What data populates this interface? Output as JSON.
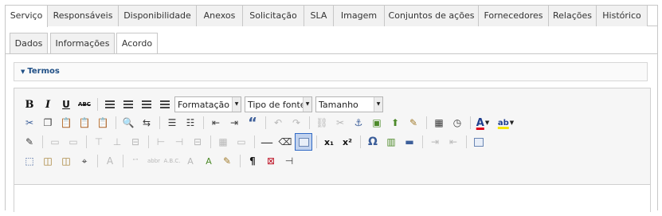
{
  "tabs": [
    {
      "label": "Serviço",
      "active": true
    },
    {
      "label": "Responsáveis",
      "active": false
    },
    {
      "label": "Disponibilidade",
      "active": false
    },
    {
      "label": "Anexos",
      "active": false
    },
    {
      "label": "Solicitação",
      "active": false
    },
    {
      "label": "SLA",
      "active": false
    },
    {
      "label": "Imagem",
      "active": false
    },
    {
      "label": "Conjuntos de ações",
      "active": false
    },
    {
      "label": "Fornecedores",
      "active": false
    },
    {
      "label": "Relações",
      "active": false
    },
    {
      "label": "Histórico",
      "active": false
    }
  ],
  "subtabs": [
    {
      "label": "Dados",
      "active": false
    },
    {
      "label": "Informações",
      "active": false
    },
    {
      "label": "Acordo",
      "active": true
    }
  ],
  "section": {
    "title": "Termos"
  },
  "editor": {
    "format_combo": "Formatação",
    "font_combo": "Tipo de fonte",
    "size_combo": "Tamanho",
    "icons": {
      "bold": "B",
      "italic": "I",
      "underline": "U",
      "strikethrough": "ABC",
      "blockquote": "“",
      "omega": "Ω",
      "pilcrow": "¶",
      "subscript": "x₁",
      "superscript": "x²",
      "anchor": "⚓"
    }
  }
}
